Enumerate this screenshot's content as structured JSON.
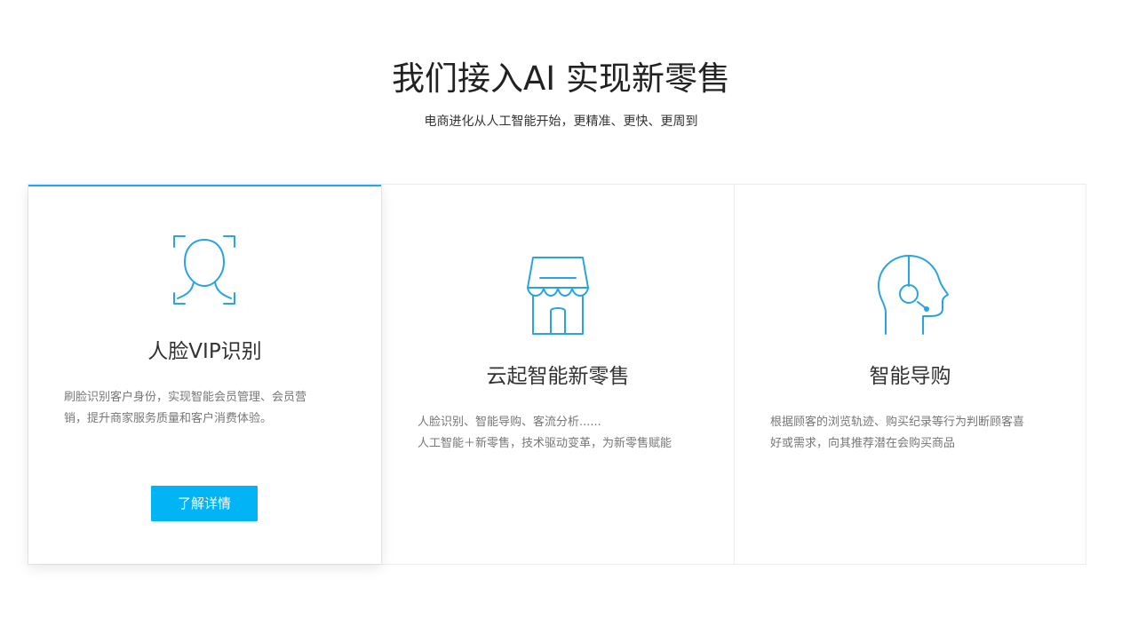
{
  "hero": {
    "title": "我们接入AI 实现新零售",
    "subtitle": "电商进化从人工智能开始，更精准、更快、更周到"
  },
  "cards": [
    {
      "icon": "face-recognition-icon",
      "title": "人脸VIP识别",
      "desc_lines": [
        "刷脸识别客户身份，实现智能会员管理、会员营",
        "销，提升商家服务质量和客户消费体验。"
      ],
      "button_label": "了解详情",
      "active": true
    },
    {
      "icon": "storefront-icon",
      "title": "云起智能新零售",
      "desc_lines": [
        "人脸识别、智能导购、客流分析......",
        "人工智能＋新零售，技术驱动变革，为新零售赋能"
      ],
      "active": false
    },
    {
      "icon": "headset-head-icon",
      "title": "智能导购",
      "desc_lines": [
        "根据顾客的浏览轨迹、购买纪录等行为判断顾客喜",
        "好或需求，向其推荐潜在会购买商品"
      ],
      "active": false
    }
  ],
  "colors": {
    "accent": "#00b4f5",
    "icon_stroke": "#29a3e2",
    "active_border": "#1da8f0"
  }
}
